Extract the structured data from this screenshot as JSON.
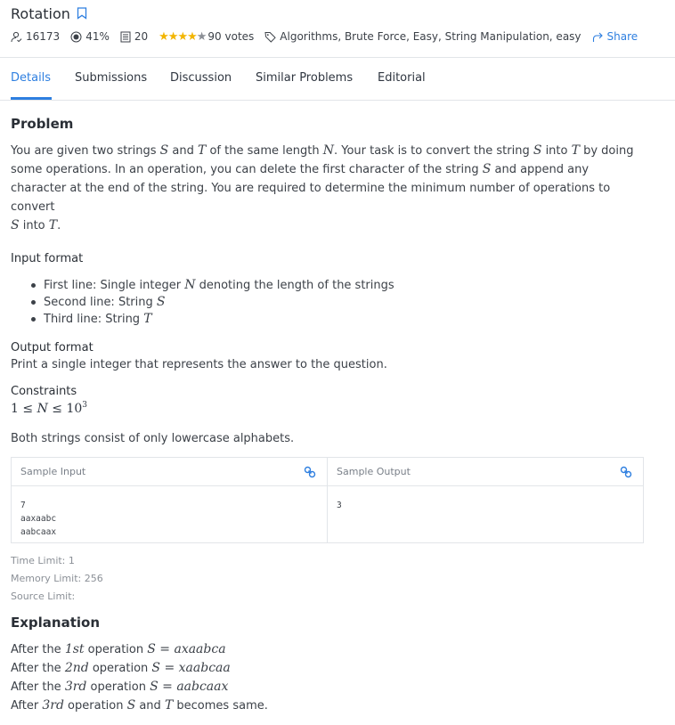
{
  "problem": {
    "title": "Rotation",
    "solved_count": "16173",
    "success_rate": "41%",
    "submissions": "20",
    "rating_stars": 4,
    "votes": "90 votes",
    "tags": "Algorithms, Brute Force, Easy, String Manipulation, easy",
    "share_label": "Share"
  },
  "tabs": [
    "Details",
    "Submissions",
    "Discussion",
    "Similar Problems",
    "Editorial"
  ],
  "active_tab": "Details",
  "sections": {
    "problem_heading": "Problem",
    "input_heading": "Input format",
    "output_heading": "Output format",
    "output_text": "Print a single integer that represents the answer to the question.",
    "constraints_heading": "Constraints",
    "constraints_note": "Both strings consist of only lowercase alphabets.",
    "explanation_heading": "Explanation"
  },
  "statement": {
    "l1a": "You are given two strings ",
    "S": "S",
    "and": " and ",
    "T": "T",
    "l1b": " of the same length ",
    "N": "N",
    "l1c": ". Your task is to convert the string ",
    "into": " into ",
    "l1d": " by doing",
    "l2": "some operations. In an operation, you can delete the first character of the string ",
    "l2b": " and append any",
    "l3": "character at the end of the string. You are required to determine the minimum number of operations to convert",
    "l4": " into ",
    "dot": "."
  },
  "input_items": {
    "first": "First line: Single integer ",
    "first_end": " denoting the length of the strings",
    "second": "Second line: String ",
    "third": "Third line: String "
  },
  "constraint_math": {
    "one": "1",
    "le": " ≤ ",
    "N": "N",
    "ten": "10",
    "exp": "3"
  },
  "sample": {
    "input_label": "Sample Input",
    "output_label": "Sample Output",
    "input": "7\naaxaabc\naabcaax",
    "output": "3"
  },
  "limits": {
    "time": "Time Limit: 1",
    "memory": "Memory Limit: 256",
    "source": "Source Limit:"
  },
  "explanation": {
    "after": "After the ",
    "op": " operation ",
    "eq": " = ",
    "row1_ord": "1st",
    "row1_val": "axaabca",
    "row2_ord": "2nd",
    "row2_val": "xaabcaa",
    "row3_ord": "3rd",
    "row3_val": "aabcaax",
    "final_a": "After ",
    "final_ord": "3rd",
    "final_b": " operation ",
    "final_c": " and ",
    "final_d": " becomes same."
  },
  "colors": {
    "accent": "#2e7fe0",
    "star": "#f2b500"
  }
}
